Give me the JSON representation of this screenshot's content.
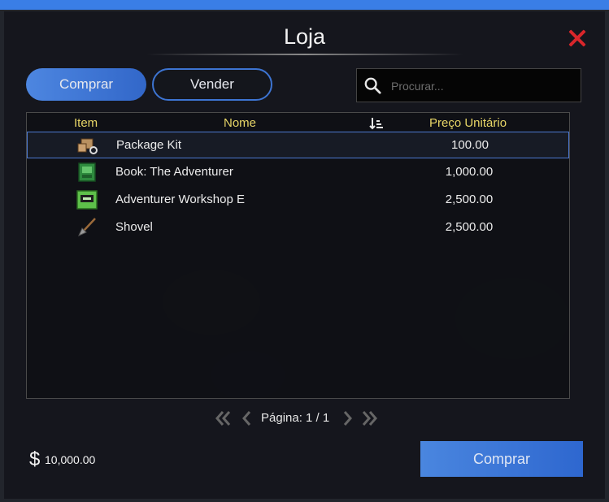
{
  "window": {
    "title": "Loja"
  },
  "tabs": [
    {
      "label": "Comprar",
      "active": true
    },
    {
      "label": "Vender",
      "active": false
    }
  ],
  "search": {
    "placeholder": "Procurar..."
  },
  "table": {
    "headers": {
      "item": "Item",
      "name": "Nome",
      "price": "Preço Unitário"
    },
    "rows": [
      {
        "icon": "package-kit-icon",
        "name": "Package Kit",
        "price": "100.00",
        "selected": true
      },
      {
        "icon": "book-icon",
        "name": "Book: The Adventurer",
        "price": "1,000.00",
        "selected": false
      },
      {
        "icon": "workshop-icon",
        "name": "Adventurer Workshop E",
        "price": "2,500.00",
        "selected": false
      },
      {
        "icon": "shovel-icon",
        "name": "Shovel",
        "price": "2,500.00",
        "selected": false
      }
    ]
  },
  "pagination": {
    "label": "Página: 1 / 1"
  },
  "balance": {
    "currency_symbol": "$",
    "amount": "10,000.00"
  },
  "buy_button": {
    "label": "Comprar"
  },
  "colors": {
    "accent": "#3a7ee6",
    "header_text": "#e8d667",
    "close": "#d9262b"
  }
}
